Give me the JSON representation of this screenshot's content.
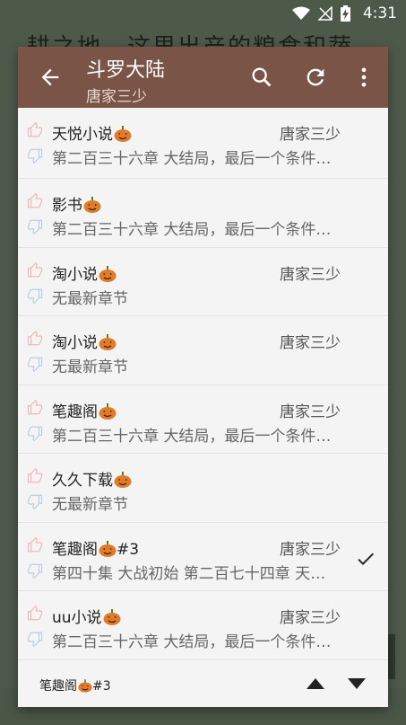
{
  "status": {
    "time": "4:31"
  },
  "background": {
    "text": "耕之地，这里出产的粮食和蔬"
  },
  "toolbar": {
    "title": "斗罗大陆",
    "subtitle": "唐家三少"
  },
  "sources": [
    {
      "name": "天悦小说",
      "author": "唐家三少",
      "chapter": "第二百三十六章 大结局，最后一个条件…",
      "selected": false
    },
    {
      "name": "影书",
      "author": "",
      "chapter": "第二百三十六章 大结局，最后一个条件…",
      "selected": false
    },
    {
      "name": "淘小说",
      "author": "唐家三少",
      "chapter": "无最新章节",
      "selected": false
    },
    {
      "name": "淘小说",
      "author": "唐家三少",
      "chapter": "无最新章节",
      "selected": false
    },
    {
      "name": "笔趣阁",
      "author": "唐家三少",
      "chapter": "第二百三十六章 大结局，最后一个条件…",
      "selected": false
    },
    {
      "name": "久久下载",
      "author": "",
      "chapter": "无最新章节",
      "selected": false
    },
    {
      "name": "笔趣阁",
      "name_suffix": "#3",
      "author": "唐家三少",
      "chapter": "第四十集 大战初始 第二百七十四章 天斗…",
      "selected": true
    },
    {
      "name": "uu小说",
      "author": "唐家三少",
      "chapter": "第二百三十六章 大结局，最后一个条件…",
      "selected": false
    }
  ],
  "footer": {
    "current_name": "笔趣阁",
    "current_suffix": "#3"
  },
  "colors": {
    "toolbar": "#7a5446",
    "dialog": "#f4f4f4",
    "pumpkin": "#e07b2a"
  },
  "icons": [
    "back-arrow-icon",
    "search-icon",
    "refresh-icon",
    "more-vert-icon",
    "thumb-up-icon",
    "thumb-down-icon",
    "check-icon",
    "pumpkin-icon",
    "arrow-up-icon",
    "arrow-down-icon"
  ]
}
